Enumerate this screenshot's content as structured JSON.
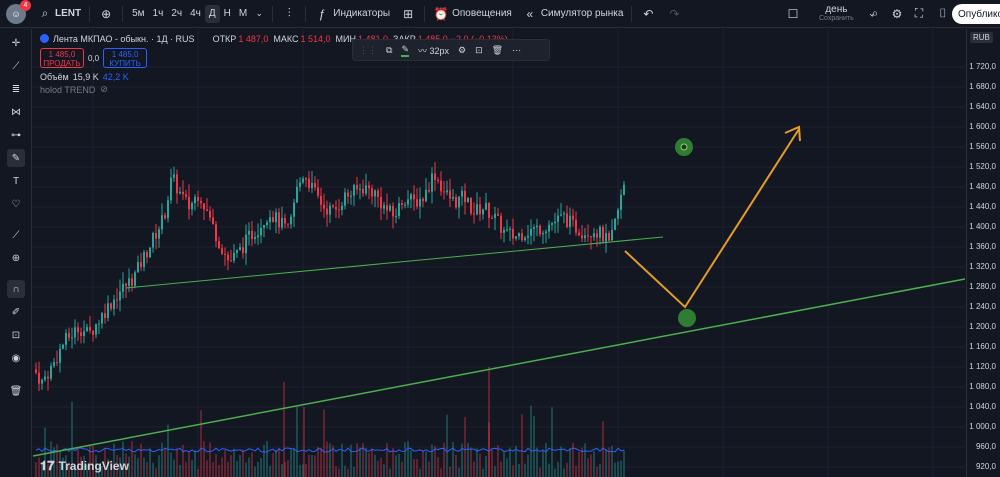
{
  "topbar": {
    "avatar_badge": "4",
    "symbol": "LENT",
    "timeframes": [
      "5м",
      "1ч",
      "2ч",
      "4ч",
      "Д",
      "Н",
      "М"
    ],
    "active_timeframe": "Д",
    "indicators": "Индикаторы",
    "alerts": "Оповещения",
    "replay": "Симулятор рынка",
    "layout_name": "день",
    "layout_status": "Сохранить",
    "publish": "Опубликовать"
  },
  "legend": {
    "title": "Лента МКПАО - обыкн. · 1Д · RUS",
    "ohlc_labels": [
      "ОТКР",
      "МАКС",
      "МИН",
      "ЗАКР"
    ],
    "ohlc_values": [
      "1 487,0",
      "1 514,0",
      "1 481,0",
      "1 485,0"
    ],
    "change": "−2,0 (−0,13%)",
    "sell_price": "1 485,0",
    "sell_label": "ПРОДАТЬ",
    "spread": "0,0",
    "buy_price": "1 485,0",
    "buy_label": "КУПИТЬ",
    "volume_label": "Объём",
    "volume_values": [
      "15,9 K",
      "42,2 K"
    ],
    "indicator_name": "holod TREND"
  },
  "float_toolbar": {
    "width_label": "32px"
  },
  "axis": {
    "currency": "RUB",
    "ticks": [
      "1 720,0",
      "1 680,0",
      "1 640,0",
      "1 600,0",
      "1 560,0",
      "1 520,0",
      "1 480,0",
      "1 440,0",
      "1 400,0",
      "1 360,0",
      "1 320,0",
      "1 280,0",
      "1 240,0",
      "1 200,0",
      "1 160,0",
      "1 120,0",
      "1 080,0",
      "1 040,0",
      "1 000,0",
      "960,0",
      "920,0"
    ]
  },
  "brand": "TradingView",
  "colors": {
    "bg": "#131722",
    "up": "#26a69a",
    "down": "#f23645",
    "trendline": "#4caf50",
    "arrow": "#e39b2a"
  }
}
